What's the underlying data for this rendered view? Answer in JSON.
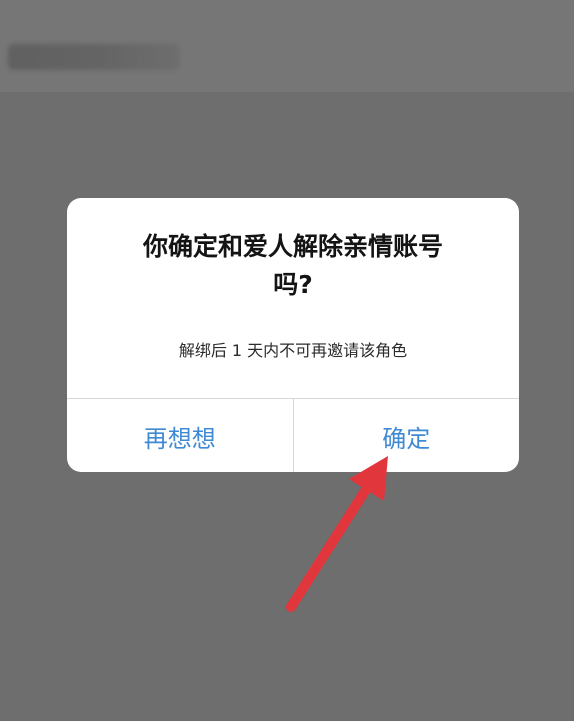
{
  "dialog": {
    "title": "你确定和爱人解除亲情账号吗?",
    "message": "解绑后 1 天内不可再邀请该角色",
    "cancel_label": "再想想",
    "confirm_label": "确定"
  }
}
